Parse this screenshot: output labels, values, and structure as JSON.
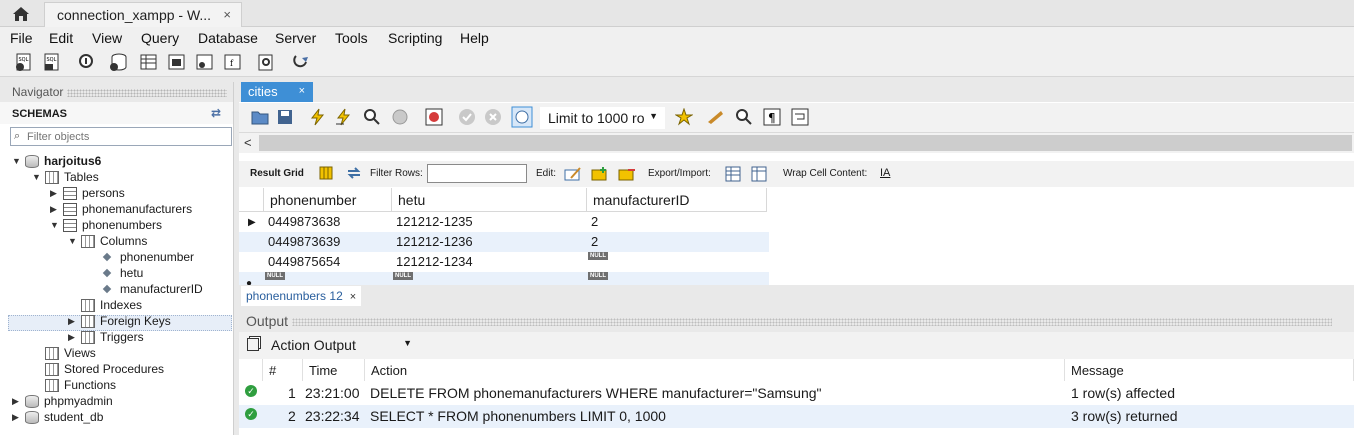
{
  "window": {
    "connection_tab_label": "connection_xampp - W...",
    "close_glyph": "×"
  },
  "menu": {
    "items": [
      "File",
      "Edit",
      "View",
      "Query",
      "Database",
      "Server",
      "Tools",
      "Scripting",
      "Help"
    ]
  },
  "navigator": {
    "header_label": "Navigator",
    "schemas_label": "SCHEMAS",
    "filter_placeholder": "Filter objects",
    "tree": {
      "schema_harjoitus6": "harjoitus6",
      "tables": "Tables",
      "persons": "persons",
      "phonemanufacturers": "phonemanufacturers",
      "phonenumbers": "phonenumbers",
      "columns": "Columns",
      "col_phonenumber": "phonenumber",
      "col_hetu": "hetu",
      "col_manufacturerID": "manufacturerID",
      "indexes": "Indexes",
      "foreign_keys": "Foreign Keys",
      "triggers": "Triggers",
      "views": "Views",
      "stored_procedures": "Stored Procedures",
      "functions": "Functions",
      "schema_phpmyadmin": "phpmyadmin",
      "schema_student_db": "student_db"
    }
  },
  "editor": {
    "tab_label": "cities",
    "limit_select_value": "Limit to 1000 ro",
    "grid_toolbar": {
      "result_grid": "Result Grid",
      "filter_rows": "Filter Rows:",
      "edit": "Edit:",
      "export_import": "Export/Import:",
      "wrap_cell": "Wrap Cell Content:"
    },
    "columns": [
      "phonenumber",
      "hetu",
      "manufacturerID"
    ],
    "rows": [
      [
        "0449873638",
        "121212-1235",
        "2"
      ],
      [
        "0449873639",
        "121212-1236",
        "2"
      ],
      [
        "0449875654",
        "121212-1234",
        "NULL"
      ],
      [
        "NULL",
        "NULL",
        "NULL"
      ]
    ],
    "null_label": "NULL"
  },
  "results_tab": {
    "label": "phonenumbers 12"
  },
  "output": {
    "header": "Output",
    "select_value": "Action Output",
    "columns": [
      "#",
      "Time",
      "Action",
      "Message"
    ],
    "rows": [
      {
        "num": "1",
        "time": "23:21:00",
        "action": "DELETE FROM phonemanufacturers WHERE manufacturer=\"Samsung\"",
        "message": "1 row(s) affected"
      },
      {
        "num": "2",
        "time": "23:22:34",
        "action": "SELECT * FROM phonenumbers LIMIT 0, 1000",
        "message": "3 row(s) returned"
      }
    ]
  },
  "colors": {
    "accent_tab": "#3e8fd6",
    "selection": "#e7eef8",
    "success": "#2f9e3f"
  }
}
